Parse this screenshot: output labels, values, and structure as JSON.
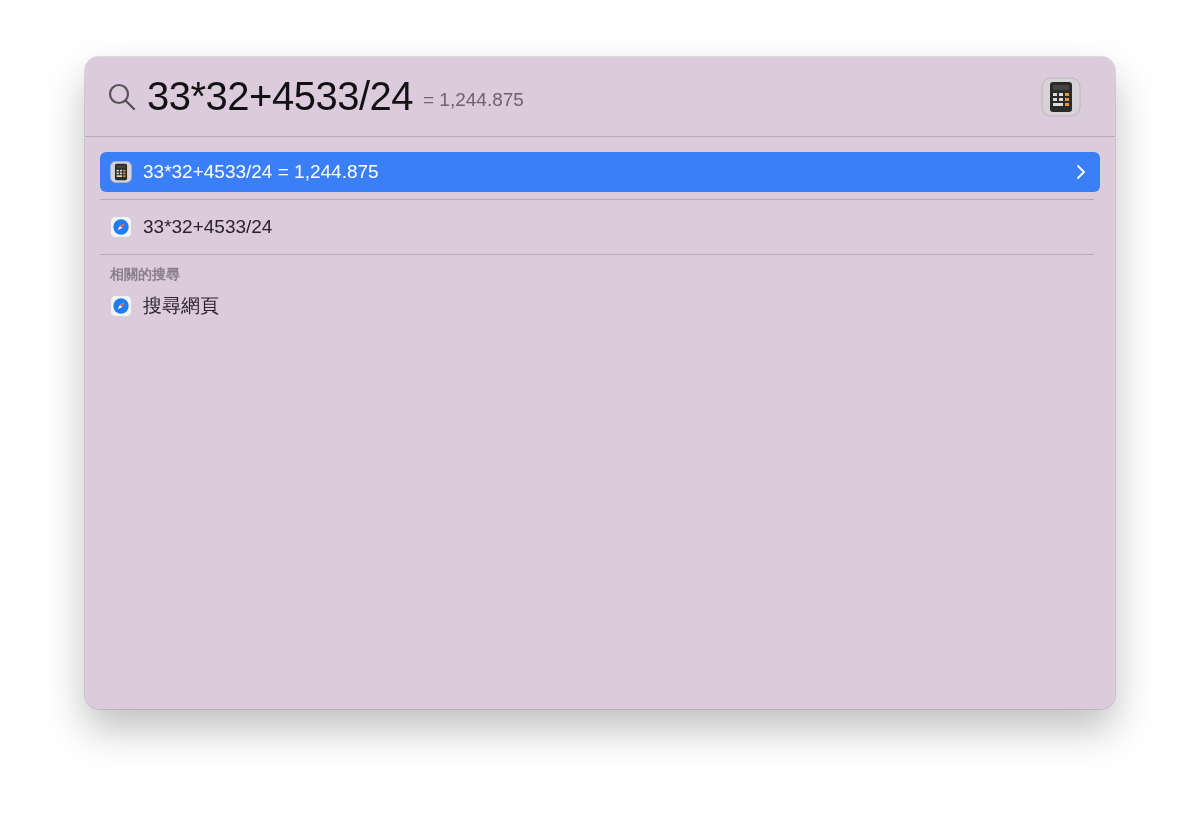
{
  "search": {
    "query": "33*32+4533/24",
    "inline_result": "= 1,244.875",
    "preview": {
      "kind": "calculator"
    }
  },
  "results": [
    {
      "kind": "calculator",
      "label": "33*32+4533/24 = 1,244.875",
      "selected": true
    },
    {
      "kind": "compass",
      "label": "33*32+4533/24",
      "selected": false
    }
  ],
  "related_searches": {
    "heading": "相關的搜尋",
    "items": [
      {
        "kind": "compass",
        "label": "搜尋網頁",
        "selected": false
      }
    ]
  }
}
